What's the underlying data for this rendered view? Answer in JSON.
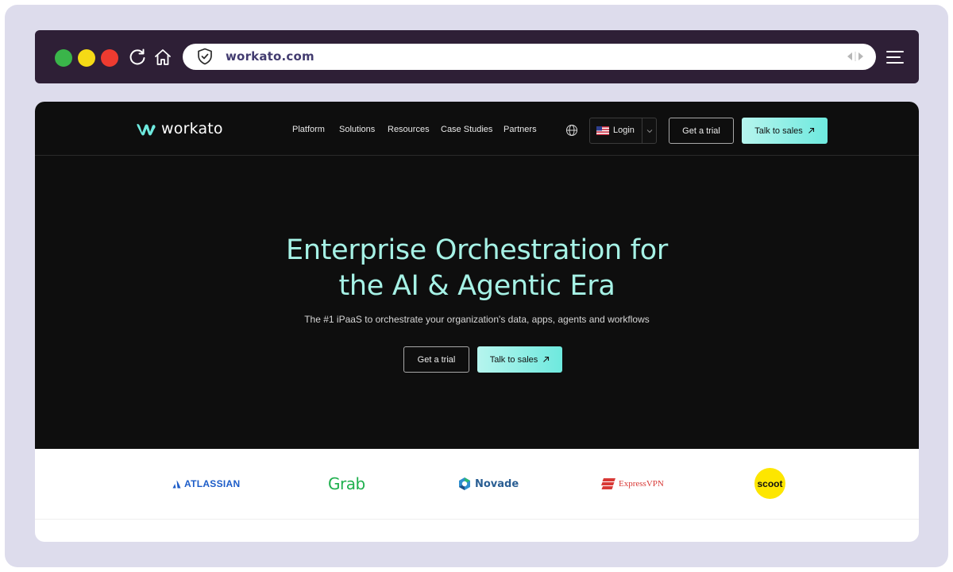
{
  "browser": {
    "url": "workato.com"
  },
  "header": {
    "logo_text": "workato",
    "nav": [
      "Platform",
      "Solutions",
      "Resources",
      "Case Studies",
      "Partners"
    ],
    "login_label": "Login",
    "trial_label": "Get a trial",
    "sales_label": "Talk to sales"
  },
  "hero": {
    "title_line1": "Enterprise Orchestration for",
    "title_line2": "the AI & Agentic Era",
    "subtitle": "The #1 iPaaS to orchestrate your organization's data, apps, agents and workflows",
    "trial_label": "Get a trial",
    "sales_label": "Talk to sales"
  },
  "logos": {
    "atlassian": "ATLASSIAN",
    "grab": "Grab",
    "novade": "Novade",
    "expressvpn": "ExpressVPN",
    "scoot": "scoot"
  },
  "colors": {
    "accent": "#6ee9de",
    "hero_text": "#a6f2e6",
    "page_bg": "#0e0e0e",
    "toolbar_bg": "#2e1f36"
  }
}
